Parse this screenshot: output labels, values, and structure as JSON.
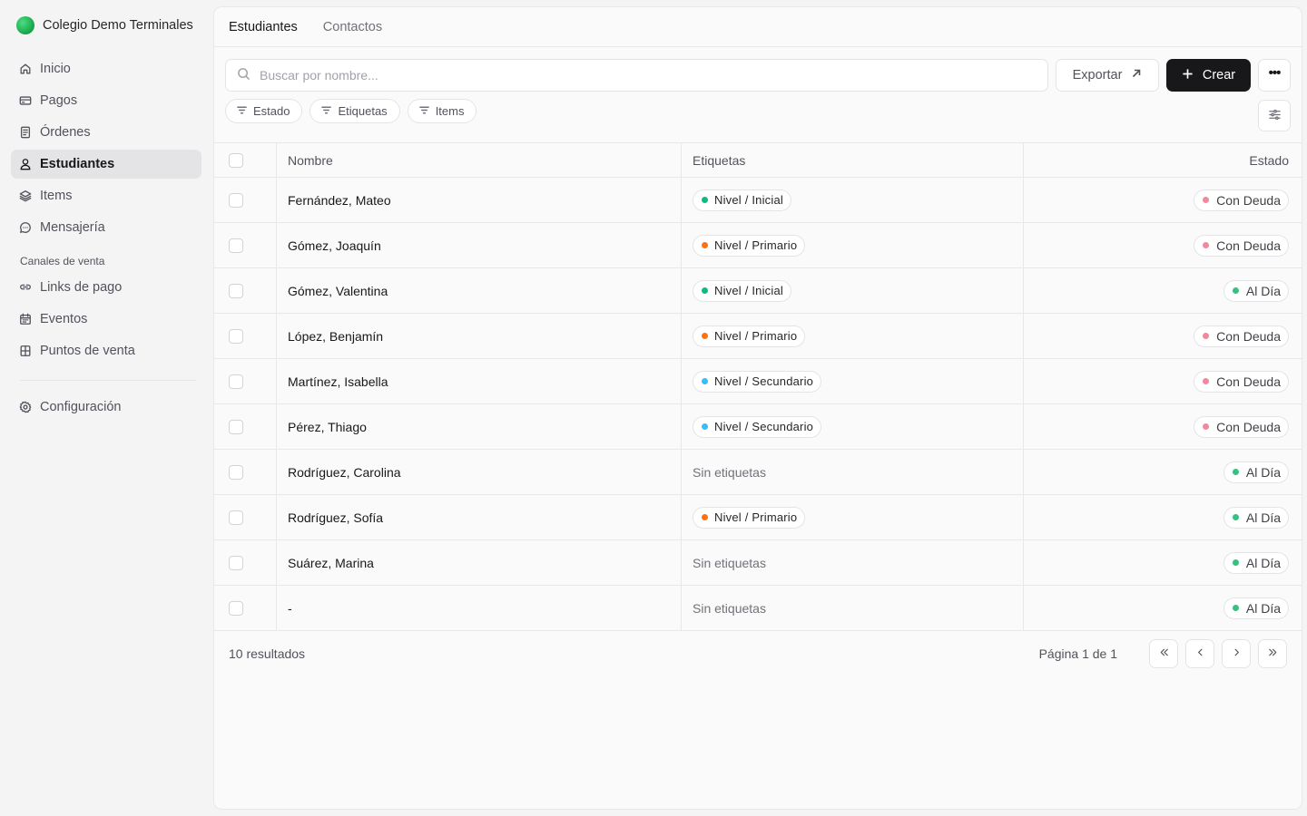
{
  "app": {
    "name": "Colegio Demo Terminales",
    "brand_color": "#22c55e"
  },
  "sidebar": {
    "items": [
      {
        "label": "Inicio",
        "icon": "home-icon",
        "active": false
      },
      {
        "label": "Pagos",
        "icon": "credit-card-icon",
        "active": false
      },
      {
        "label": "Órdenes",
        "icon": "receipt-icon",
        "active": false
      },
      {
        "label": "Estudiantes",
        "icon": "user-icon",
        "active": true
      },
      {
        "label": "Items",
        "icon": "layers-icon",
        "active": false
      },
      {
        "label": "Mensajería",
        "icon": "chat-icon",
        "active": false
      }
    ],
    "section_label": "Canales de venta",
    "channels": [
      {
        "label": "Links de pago",
        "icon": "link-icon"
      },
      {
        "label": "Eventos",
        "icon": "calendar-icon"
      },
      {
        "label": "Puntos de venta",
        "icon": "store-icon"
      }
    ],
    "settings_label": "Configuración"
  },
  "tabs": [
    {
      "label": "Estudiantes",
      "active": true
    },
    {
      "label": "Contactos",
      "active": false
    }
  ],
  "toolbar": {
    "search_placeholder": "Buscar por nombre...",
    "search_value": "",
    "export_label": "Exportar",
    "create_label": "Crear"
  },
  "filters": [
    "Estado",
    "Etiquetas",
    "Items"
  ],
  "table": {
    "headers": {
      "name": "Nombre",
      "tags": "Etiquetas",
      "status": "Estado"
    },
    "rows": [
      {
        "name": "Fernández, Mateo",
        "tag": "Nivel / Inicial",
        "tag_color": "#10b981",
        "status": "Con Deuda",
        "status_color": "#f2889b"
      },
      {
        "name": "Gómez, Joaquín",
        "tag": "Nivel / Primario",
        "tag_color": "#f97316",
        "status": "Con Deuda",
        "status_color": "#f2889b"
      },
      {
        "name": "Gómez, Valentina",
        "tag": "Nivel / Inicial",
        "tag_color": "#10b981",
        "status": "Al Día",
        "status_color": "#34c37f"
      },
      {
        "name": "López, Benjamín",
        "tag": "Nivel / Primario",
        "tag_color": "#f97316",
        "status": "Con Deuda",
        "status_color": "#f2889b"
      },
      {
        "name": "Martínez, Isabella",
        "tag": "Nivel / Secundario",
        "tag_color": "#38bdf8",
        "status": "Con Deuda",
        "status_color": "#f2889b"
      },
      {
        "name": "Pérez, Thiago",
        "tag": "Nivel / Secundario",
        "tag_color": "#38bdf8",
        "status": "Con Deuda",
        "status_color": "#f2889b"
      },
      {
        "name": "Rodríguez, Carolina",
        "tag": null,
        "tag_color": null,
        "status": "Al Día",
        "status_color": "#34c37f"
      },
      {
        "name": "Rodríguez, Sofía",
        "tag": "Nivel / Primario",
        "tag_color": "#f97316",
        "status": "Al Día",
        "status_color": "#34c37f"
      },
      {
        "name": "Suárez, Marina",
        "tag": null,
        "tag_color": null,
        "status": "Al Día",
        "status_color": "#34c37f"
      },
      {
        "name": "-",
        "tag": null,
        "tag_color": null,
        "status": "Al Día",
        "status_color": "#34c37f"
      }
    ],
    "empty_tags_label": "Sin etiquetas"
  },
  "footer": {
    "results_label": "10 resultados",
    "page_label": "Página 1 de 1"
  }
}
